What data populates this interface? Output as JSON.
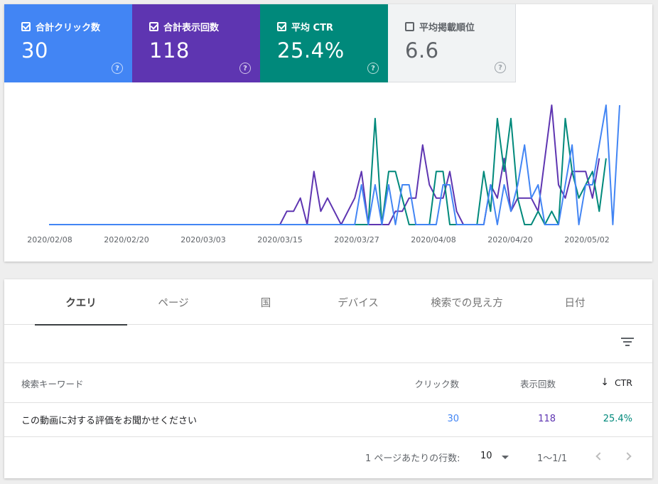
{
  "metrics": [
    {
      "id": "clicks",
      "label": "合計クリック数",
      "value": "30",
      "checked": true,
      "color": "#4285f4"
    },
    {
      "id": "impressions",
      "label": "合計表示回数",
      "value": "118",
      "checked": true,
      "color": "#5e35b1"
    },
    {
      "id": "ctr",
      "label": "平均 CTR",
      "value": "25.4%",
      "checked": true,
      "color": "#00897b"
    },
    {
      "id": "position",
      "label": "平均掲載順位",
      "value": "6.6",
      "checked": false,
      "color": "#f1f3f4"
    }
  ],
  "help_glyph": "?",
  "chart_data": {
    "type": "line",
    "x_tick_labels": [
      "2020/02/08",
      "2020/02/20",
      "2020/03/03",
      "2020/03/15",
      "2020/03/27",
      "2020/04/08",
      "2020/04/20",
      "2020/05/02"
    ],
    "series": [
      {
        "name": "合計表示回数",
        "color": "#5e35b1",
        "values": [
          0,
          0,
          0,
          0,
          0,
          0,
          0,
          0,
          0,
          0,
          0,
          0,
          0,
          0,
          0,
          0,
          0,
          0,
          0,
          0,
          0,
          0,
          0,
          0,
          0,
          0,
          0,
          0,
          0,
          0,
          0,
          0,
          0,
          0,
          0,
          1,
          1,
          2,
          0,
          4,
          1,
          2,
          1,
          0,
          1,
          2,
          4,
          0,
          0,
          0,
          0,
          1,
          1,
          2,
          2,
          6,
          3,
          2,
          2,
          4,
          1,
          0,
          0,
          0,
          0,
          3,
          2,
          5,
          1,
          2,
          2,
          2,
          1,
          5,
          9,
          3,
          2,
          4,
          4,
          4,
          2,
          5
        ]
      },
      {
        "name": "平均 CTR",
        "color": "#00897b",
        "values": [
          0,
          0,
          0,
          0,
          0,
          0,
          0,
          0,
          0,
          0,
          0,
          0,
          0,
          0,
          0,
          0,
          0,
          0,
          0,
          0,
          0,
          0,
          0,
          0,
          0,
          0,
          0,
          0,
          0,
          0,
          0,
          0,
          0,
          0,
          0,
          0,
          0,
          0,
          0,
          0,
          0,
          0,
          0,
          0,
          0,
          0,
          0,
          0,
          8,
          0,
          4,
          4,
          2,
          0,
          0,
          0,
          0,
          4,
          4,
          0,
          0,
          0,
          0,
          0,
          4,
          1,
          8,
          4,
          8,
          2,
          0,
          0,
          1,
          0,
          1,
          0,
          8,
          4,
          2,
          3,
          4,
          1,
          5
        ]
      },
      {
        "name": "合計クリック数",
        "color": "#4285f4",
        "values": [
          0,
          0,
          0,
          0,
          0,
          0,
          0,
          0,
          0,
          0,
          0,
          0,
          0,
          0,
          0,
          0,
          0,
          0,
          0,
          0,
          0,
          0,
          0,
          0,
          0,
          0,
          0,
          0,
          0,
          0,
          0,
          0,
          0,
          0,
          0,
          0,
          0,
          0,
          0,
          0,
          0,
          0,
          0,
          0,
          0,
          0,
          3,
          0,
          3,
          0,
          3,
          0,
          3,
          3,
          0,
          0,
          0,
          0,
          3,
          3,
          0,
          0,
          0,
          0,
          0,
          3,
          0,
          3,
          1,
          3,
          6,
          2,
          3,
          0,
          0,
          0,
          3,
          6,
          0,
          3,
          3,
          6,
          9,
          0,
          9
        ]
      }
    ]
  },
  "tabs": [
    "クエリ",
    "ページ",
    "国",
    "デバイス",
    "検索での見え方",
    "日付"
  ],
  "table": {
    "headers": {
      "keyword": "検索キーワード",
      "clicks": "クリック数",
      "impressions": "表示回数",
      "ctr": "CTR"
    },
    "sort_arrow": "↓",
    "rows": [
      {
        "keyword": "この動画に対する評価をお聞かせください",
        "clicks": "30",
        "impressions": "118",
        "ctr": "25.4%"
      }
    ]
  },
  "pagination": {
    "rows_per_page_label": "1 ページあたりの行数:",
    "rows_per_page": "10",
    "range": "1〜1/1"
  }
}
